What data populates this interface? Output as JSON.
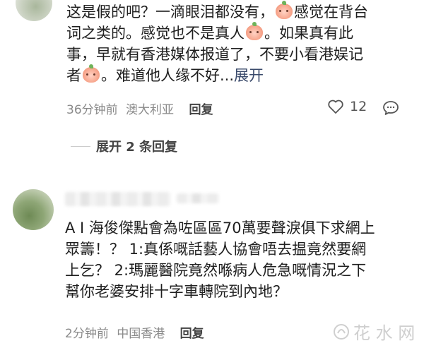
{
  "comment1": {
    "lines": [
      "这是假的吧？一滴眼泪都没有，",
      "感觉在背台",
      "词之类的。感觉也不是真人",
      "。如果真有此",
      "事，早就有香港媒体报道了，不要小看港娱记",
      "者",
      "。难道他人缘不好...",
      "展开"
    ],
    "time": "36分钟前",
    "location": "澳大利亚",
    "reply_label": "回复",
    "like_count": "12",
    "expand_replies": "展开 2 条回复"
  },
  "comment2": {
    "lines": [
      "A I 海俊傑點會為咗區區70萬要聲淚俱下求網上",
      "眾籌！？ 1:真係嘅話藝人協會唔去揾竟然要網",
      "上乞？ 2:瑪麗醫院竟然喺病人危急嘅情況之下",
      "幫你老婆安排十字車轉院到內地？"
    ],
    "time": "2分钟前",
    "location": "中国香港",
    "reply_label": "回复"
  },
  "watermark": "花 水 网",
  "icons": {
    "emoji": "peach-emoji-icon",
    "like": "heart-outline-icon",
    "comment": "speech-bubble-icon",
    "watermark": "watermark-logo-icon"
  },
  "colors": {
    "text": "#1f1f1f",
    "meta": "#8a8a8a",
    "link": "#3a4a6b"
  }
}
